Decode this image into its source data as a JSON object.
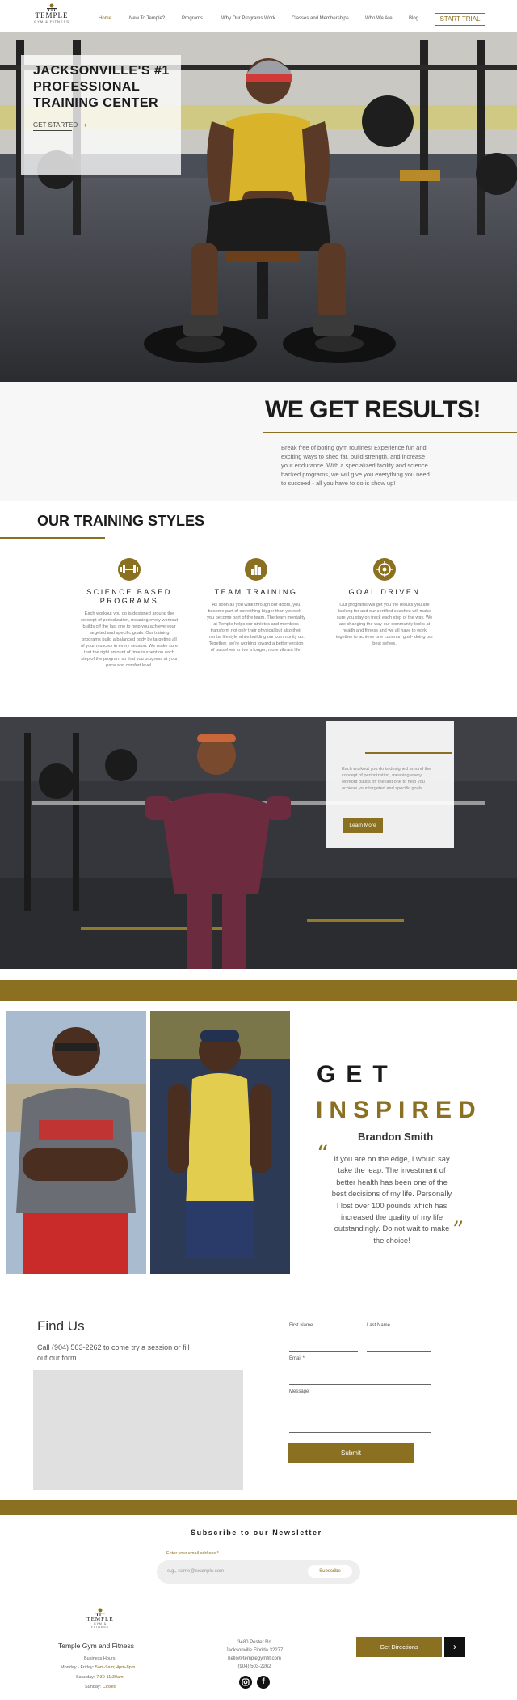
{
  "header": {
    "logo_text": "TEMPLE",
    "logo_sub": "GYM & FITNESS",
    "nav": [
      "Home",
      "New To Temple?",
      "Programs",
      "Why Our Programs Work",
      "Classes and Memberships",
      "Who We Are",
      "Blog"
    ],
    "start_trial": "START TRIAL"
  },
  "hero": {
    "title": "JACKSONVILLE'S #1 PROFESSIONAL TRAINING CENTER",
    "cta": "GET STARTED",
    "cta_icon": "chevron-right-icon"
  },
  "results": {
    "title": "WE GET RESULTS!",
    "body": "Break free of boring gym routines! Experience fun and exciting ways to shed fat, build strength, and increase your endurance. With a specialized facility and science backed programs, we will give you everything you need to succeed - all you have to do is show up!"
  },
  "training": {
    "title": "OUR TRAINING STYLES",
    "features": [
      {
        "icon": "dumbbell-icon",
        "title": "SCIENCE BASED PROGRAMS",
        "body": "Each workout you do is designed around the concept of periodization, meaning every workout builds off the last one to help you achieve your targeted and specific goals. Our training programs build a balanced body by targeting all of your muscles in every session. We make sure that the right amount of time is spent on each step of the program so that you progress at your pace and comfort level."
      },
      {
        "icon": "bar-chart-icon",
        "title": "TEAM TRAINING",
        "body": "As soon as you walk through our doors, you become part of something bigger than yourself - you become part of the team. The team mentality at Temple helps our athletes and members transform not only their physical but also their mental lifestyle while building our community up. Together, we're working toward a better version of ourselves to live a longer, more vibrant life."
      },
      {
        "icon": "target-icon",
        "title": "GOAL DRIVEN",
        "body": "Our programs will get you the results you are looking for and our certified coaches will make sure you stay on track each step of the way. We are changing the way our community looks at health and fitness and we all have to work together to achieve one common goal- doing our best selves."
      }
    ]
  },
  "promo": {
    "body": "Each workout you do is designed around the concept of periodization, meaning every workout builds off the last one to help you achieve your targeted and specific goals.",
    "button": "Learn More"
  },
  "inspired": {
    "get": "GET",
    "inspired": "INSPIRED",
    "name": "Brandon Smith",
    "quote": "If you are on the edge, I would say take the leap. The investment of better health has been one of the best decisions of my life. Personally I lost over 100 pounds which has increased the quality of my life outstandingly. Do not wait to make the choice!"
  },
  "find_us": {
    "title": "Find Us",
    "body": "Call (904) 503-2262 to come try a session or fill out our form",
    "first_name": "First Name",
    "last_name": "Last Name",
    "email": "Email *",
    "message": "Message",
    "submit": "Submit"
  },
  "newsletter": {
    "title": "Subscribe to our Newsletter",
    "label": "Enter your email address *",
    "placeholder": "e.g., name@example.com",
    "button": "Subscribe"
  },
  "footer": {
    "name": "Temple Gym and Fitness",
    "hours_title": "Business Hours",
    "hours_weekday_label": "Monday - Friday:",
    "hours_weekday": "5am-9am; 4pm-8pm",
    "hours_sat_label": "Saturday:",
    "hours_sat": "7:30-11:30am",
    "hours_sun_label": "Sunday:",
    "hours_sun": "Closed",
    "address_line1": "3480 Pester Rd",
    "address_line2": "Jacksonville Florida 32277",
    "email": "hello@templegymfit.com",
    "phone": "(904) 503-2262",
    "directions": "Get Directions",
    "directions_icon": "chevron-right-icon"
  },
  "colors": {
    "accent": "#8a7020",
    "dark": "#1b1b1b"
  }
}
